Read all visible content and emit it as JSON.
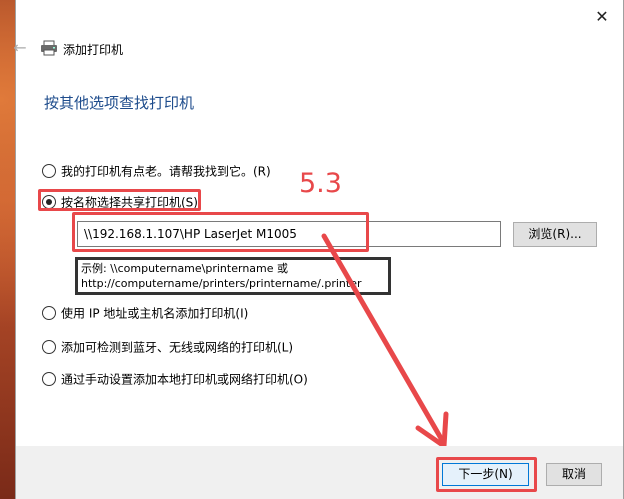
{
  "window": {
    "close_glyph": "✕"
  },
  "header": {
    "back_glyph": "←",
    "title": "添加打印机"
  },
  "heading": "按其他选项查找打印机",
  "options": [
    {
      "label": "我的打印机有点老。请帮我找到它。(R)",
      "checked": false
    },
    {
      "label": "按名称选择共享打印机(S)",
      "checked": true
    },
    {
      "label": "使用 IP 地址或主机名添加打印机(I)",
      "checked": false
    },
    {
      "label": "添加可检测到蓝牙、无线或网络的打印机(L)",
      "checked": false
    },
    {
      "label": "通过手动设置添加本地打印机或网络打印机(O)",
      "checked": false
    }
  ],
  "shared_printer": {
    "value": "\\\\192.168.1.107\\HP LaserJet M1005",
    "browse_label": "浏览(R)...",
    "example_line1": "示例: \\\\computername\\printername 或",
    "example_line2": "http://computername/printers/printername/.printer"
  },
  "annotation": "5.3",
  "footer": {
    "next_label": "下一步(N)",
    "cancel_label": "取消"
  },
  "colors": {
    "heading": "#1e4c8c",
    "annotation_red": "#e8484a",
    "primary_border": "#0078d7"
  }
}
